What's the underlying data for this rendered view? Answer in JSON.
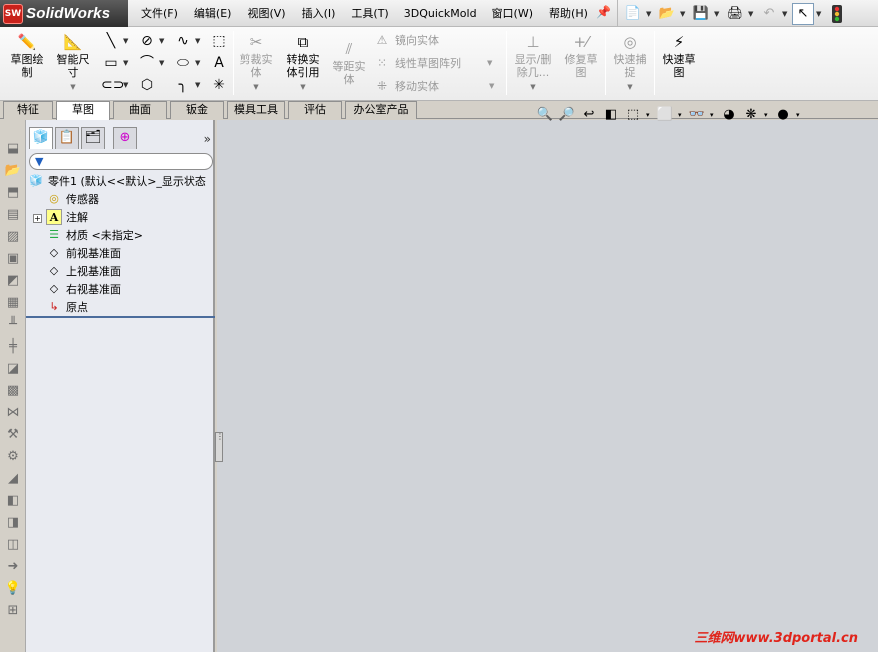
{
  "app": {
    "name": "SolidWorks",
    "badge": "SW"
  },
  "menu": {
    "items": [
      "文件(F)",
      "编辑(E)",
      "视图(V)",
      "插入(I)",
      "工具(T)",
      "3DQuickMold",
      "窗口(W)",
      "帮助(H)"
    ]
  },
  "commands": {
    "sketch": "草图绘\n制",
    "smart_dimension": "智能尺\n寸",
    "trim": "剪裁实\n体",
    "convert": "转换实\n体引用",
    "offset": "等距实\n体",
    "mirror": "镜向实体",
    "linear_pattern": "线性草图阵列",
    "move": "移动实体",
    "show_delete": "显示/删\n除几...",
    "repair": "修复草\n图",
    "quick_snap": "快速捕\n捉",
    "rapid_sketch": "快速草\n图"
  },
  "tabs": [
    "特征",
    "草图",
    "曲面",
    "钣金",
    "模具工具",
    "评估",
    "办公室产品"
  ],
  "active_tab": "草图",
  "tree": {
    "root": "零件1  (默认<<默认>_显示状态",
    "items": [
      {
        "label": "传感器"
      },
      {
        "label": "注解"
      },
      {
        "label": "材质 <未指定>"
      },
      {
        "label": "前视基准面"
      },
      {
        "label": "上视基准面"
      },
      {
        "label": "右视基准面"
      },
      {
        "label": "原点"
      }
    ]
  },
  "watermark": "三维网www.3dportal.cn"
}
